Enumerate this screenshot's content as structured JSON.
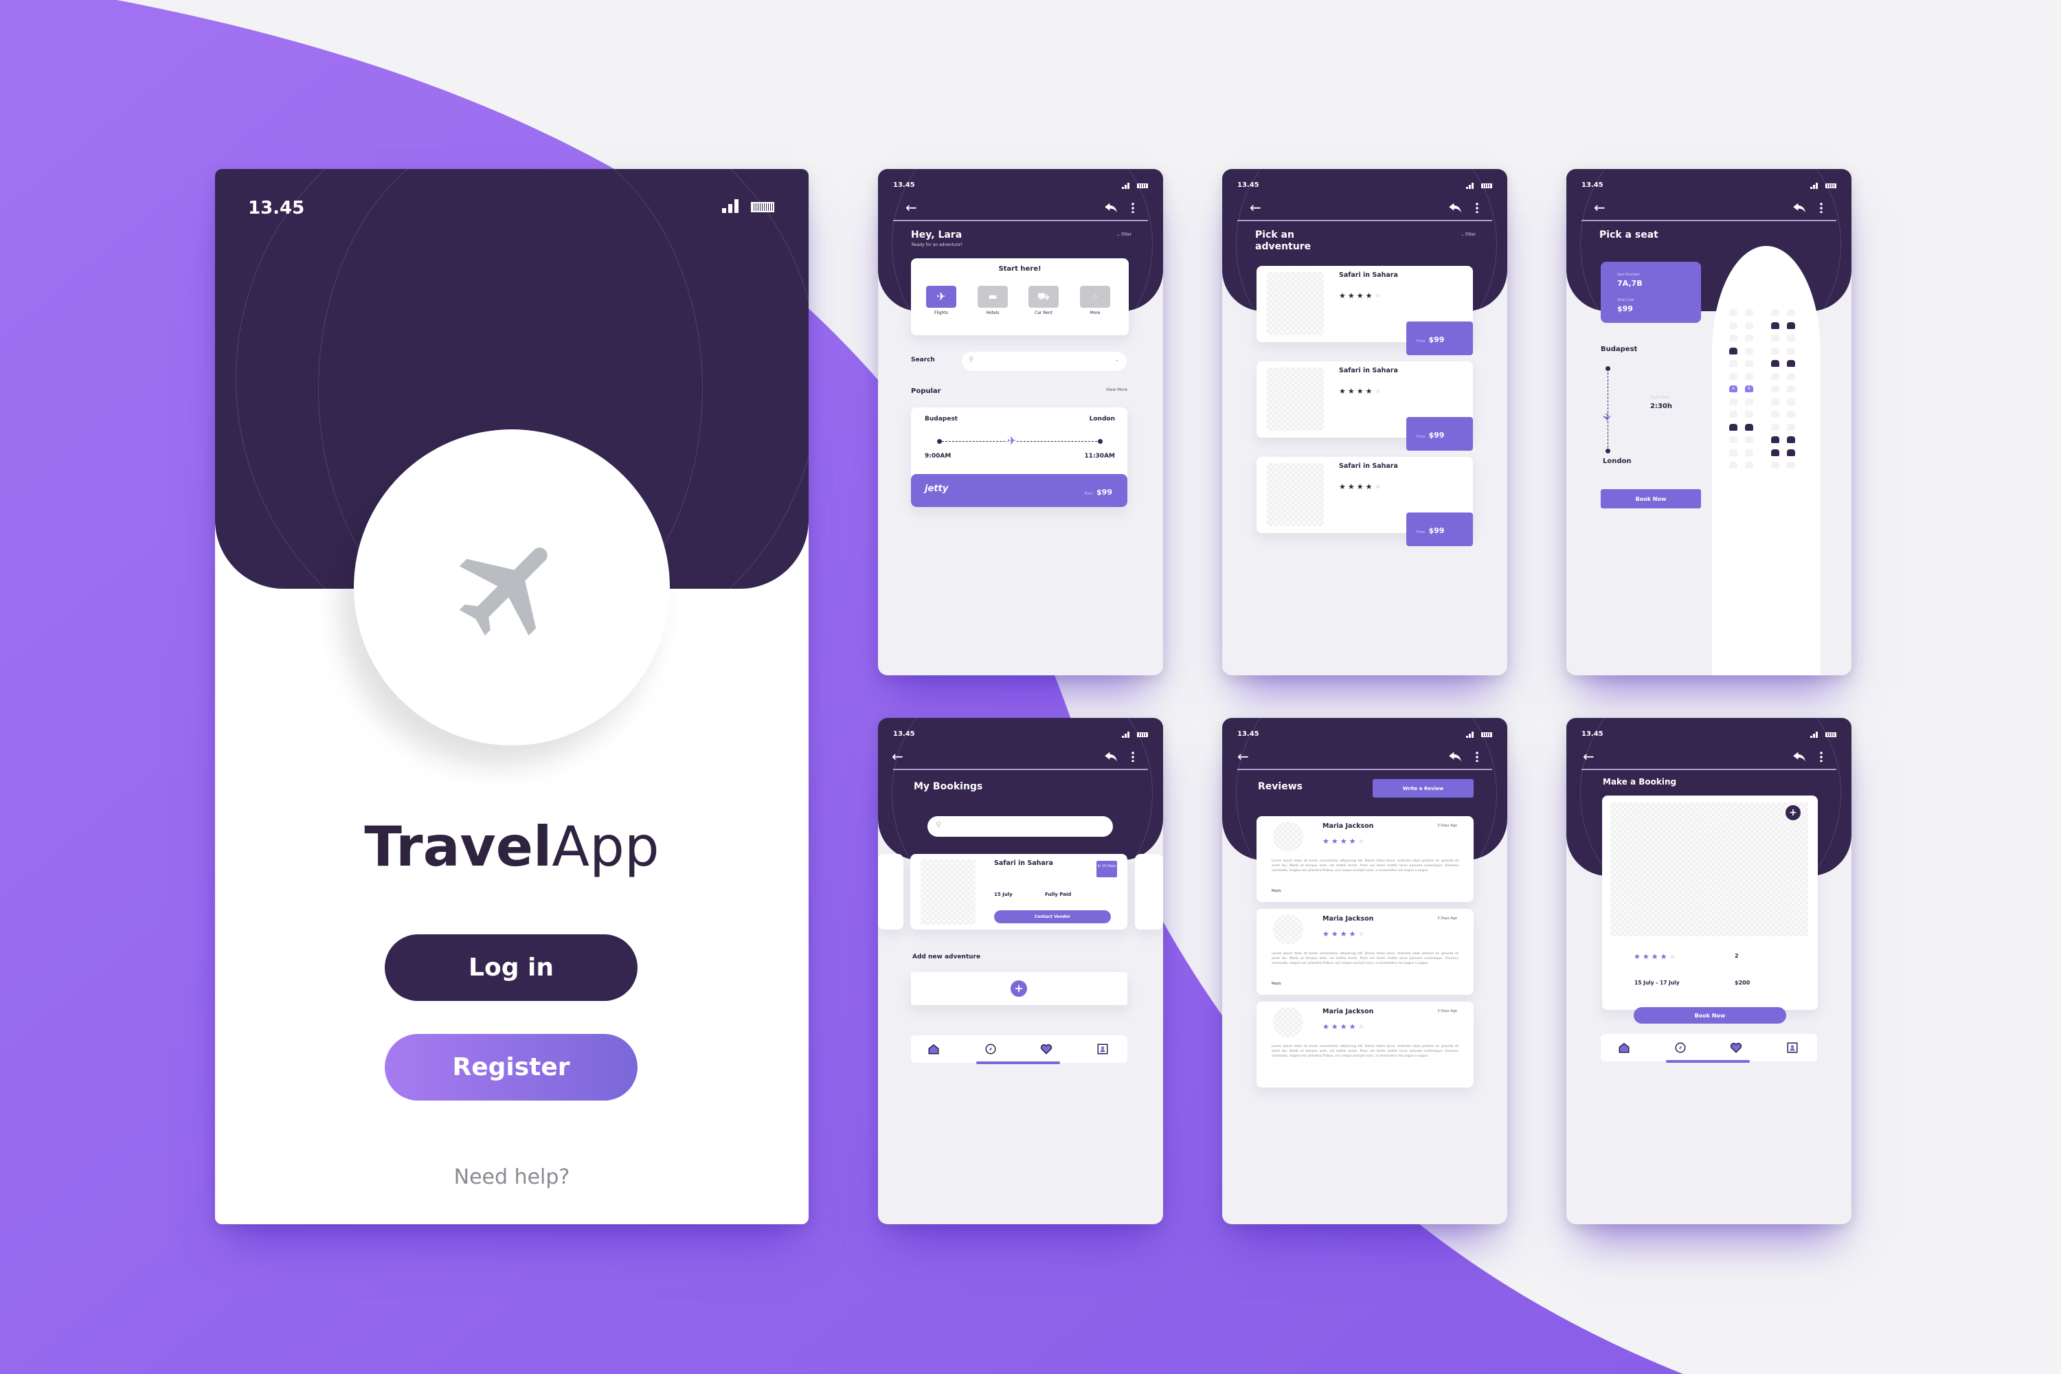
{
  "colors": {
    "dark": "#35264f",
    "accent": "#7b68d9",
    "background_purple": "#9466ee"
  },
  "status": {
    "time": "13.45"
  },
  "login": {
    "title_bold": "Travel",
    "title_light": "App",
    "login_button": "Log in",
    "register_button": "Register",
    "help_link": "Need help?",
    "hero_icon": "airplane-icon"
  },
  "home": {
    "greeting": "Hey, Lara",
    "subtitle": "Ready for an adventure?",
    "filter": "Filter",
    "start_title": "Start here!",
    "categories": [
      {
        "label": "Flights",
        "icon": "airplane-icon",
        "active": true
      },
      {
        "label": "Hotels",
        "icon": "bed-icon"
      },
      {
        "label": "Car Rent",
        "icon": "car-icon"
      },
      {
        "label": "More",
        "icon": "grid-icon"
      }
    ],
    "search_label": "Search",
    "popular": "Popular",
    "view_more": "View More",
    "flight": {
      "from": "Budapest",
      "to": "London",
      "departure": "9:00AM",
      "arrival": "11:30AM",
      "airline": "jetty",
      "from_label": "From",
      "price": "$99"
    }
  },
  "adventures": {
    "title_line1": "Pick an",
    "title_line2": "adventure",
    "filter": "Filter",
    "items": [
      {
        "name": "Safari in Sahara",
        "rating": 4,
        "from_label": "From",
        "price": "$99"
      },
      {
        "name": "Safari in Sahara",
        "rating": 4,
        "from_label": "From",
        "price": "$99"
      },
      {
        "name": "Safari in Sahara",
        "rating": 4,
        "from_label": "From",
        "price": "$99"
      }
    ]
  },
  "seat": {
    "title": "Pick a seat",
    "seat_label": "Seat Number",
    "seats": "7A,7B",
    "cost_label": "Total Cost",
    "cost": "$99",
    "from": "Budapest",
    "to": "London",
    "flight_time_label": "Flight Time",
    "duration": "2:30h",
    "book": "Book Now",
    "seat_map": [
      [
        0,
        0,
        0,
        0
      ],
      [
        0,
        0,
        1,
        1
      ],
      [
        0,
        0,
        0,
        0
      ],
      [
        1,
        0,
        0,
        0
      ],
      [
        0,
        0,
        1,
        1
      ],
      [
        0,
        0,
        0,
        0
      ],
      [
        2,
        2,
        0,
        0
      ],
      [
        0,
        0,
        0,
        0
      ],
      [
        0,
        0,
        0,
        0
      ],
      [
        1,
        1,
        0,
        0
      ],
      [
        0,
        0,
        1,
        1
      ],
      [
        0,
        0,
        1,
        1
      ],
      [
        0,
        0,
        0,
        0
      ]
    ],
    "selected_labels": [
      "A",
      "B"
    ]
  },
  "bookings": {
    "title": "My Bookings",
    "card": {
      "name": "Safari in Sahara",
      "badge": "In 15 Days",
      "date": "15 July",
      "payment": "Fully Paid",
      "contact": "Contact Vendor"
    },
    "add_title": "Add new adventure"
  },
  "reviews": {
    "title": "Reviews",
    "write": "Write a Review",
    "items": [
      {
        "name": "Maria Jackson",
        "time": "3 Days Ago",
        "rating": 4,
        "text": "Lorem ipsum dolor sit amet, consectetur adipiscing elit. Donec tellus lacus, molestie vitae pretium at, gravida sit amet dui. Morbi ut tempus ante, vel mattis lorem. Proin vel lorem mattis lacus posuere scelerisque. Vivamus commodo, magna nec pharetra finibus, orci neque suscipit nunc, a consectetur est augue a augue.",
        "reply": "Reply"
      },
      {
        "name": "Maria Jackson",
        "time": "3 Days Ago",
        "rating": 4,
        "text": "Lorem ipsum dolor sit amet, consectetur adipiscing elit. Donec tellus lacus, molestie vitae pretium at, gravida sit amet dui. Morbi ut tempus ante, vel mattis lorem. Proin vel lorem mattis lacus posuere scelerisque. Vivamus commodo, magna nec pharetra finibus, orci neque suscipit nunc, a consectetur est augue a augue.",
        "reply": "Reply"
      },
      {
        "name": "Maria Jackson",
        "time": "3 Days Ago",
        "rating": 4,
        "text": "Lorem ipsum dolor sit amet, consectetur adipiscing elit. Donec tellus lacus, molestie vitae pretium at, gravida sit amet dui. Morbi ut tempus ante, vel mattis lorem. Proin vel lorem mattis lacus posuere scelerisque. Vivamus commodo, magna nec pharetra finibus, orci neque suscipit nunc, a consectetur est augue a augue."
      }
    ]
  },
  "make_booking": {
    "title": "Make a Booking",
    "rating": 4,
    "guests": "2",
    "dates": "15 July - 17 July",
    "price": "$200",
    "book": "Book Now"
  },
  "bottom_nav": [
    "home-icon",
    "compass-icon",
    "heart-icon",
    "profile-icon"
  ]
}
